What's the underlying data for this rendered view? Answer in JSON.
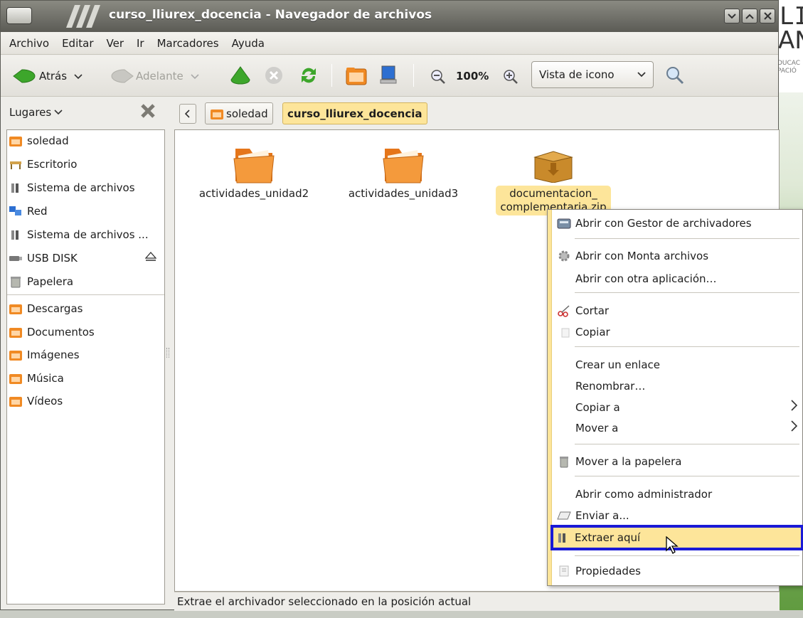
{
  "window": {
    "title": "curso_lliurex_docencia - Navegador de archivos"
  },
  "desktop": {
    "text_top": "LIIA",
    "text_mid": "AN",
    "text_small1": "DUCAC",
    "text_small2": "PACIÓ"
  },
  "menubar": {
    "archivo": "Archivo",
    "editar": "Editar",
    "ver": "Ver",
    "ir": "Ir",
    "marcadores": "Marcadores",
    "ayuda": "Ayuda"
  },
  "toolbar": {
    "back_label": "Atrás",
    "forward_label": "Adelante",
    "zoom_level": "100%",
    "view_mode": "Vista de icono"
  },
  "location": {
    "sidebar_selector": "Lugares",
    "crumb_home": "soledad",
    "crumb_current": "curso_lliurex_docencia"
  },
  "sidebar": {
    "places": [
      "soledad",
      "Escritorio",
      "Sistema de archivos",
      "Red",
      "Sistema de archivos ...",
      "USB DISK",
      "Papelera"
    ],
    "bookmarks": [
      "Descargas",
      "Documentos",
      "Imágenes",
      "Música",
      "Vídeos"
    ]
  },
  "files": [
    {
      "name": "actividades_unidad2",
      "type": "folder"
    },
    {
      "name": "actividades_unidad3",
      "type": "folder"
    },
    {
      "name_line1": "documentacion_",
      "name_line2": "complementaria.zip",
      "type": "archive",
      "selected": true
    }
  ],
  "context_menu": {
    "open_archiver": "Abrir con Gestor de archivadores",
    "open_mount": "Abrir con Monta archivos",
    "open_other": "Abrir con otra aplicación…",
    "cut": "Cortar",
    "copy": "Copiar",
    "make_link": "Crear un enlace",
    "rename": "Renombrar…",
    "copy_to": "Copiar a",
    "move_to": "Mover a",
    "trash": "Mover a la papelera",
    "open_admin": "Abrir como administrador",
    "send_to": "Enviar a...",
    "extract_here": "Extraer aquí",
    "properties": "Propiedades"
  },
  "status": {
    "text": "Extrae el archivador seleccionado en la posición actual"
  },
  "colors": {
    "selection": "#fde59a",
    "highlight_outline": "#1a1ad6",
    "titlebar": "#5b5b55"
  }
}
